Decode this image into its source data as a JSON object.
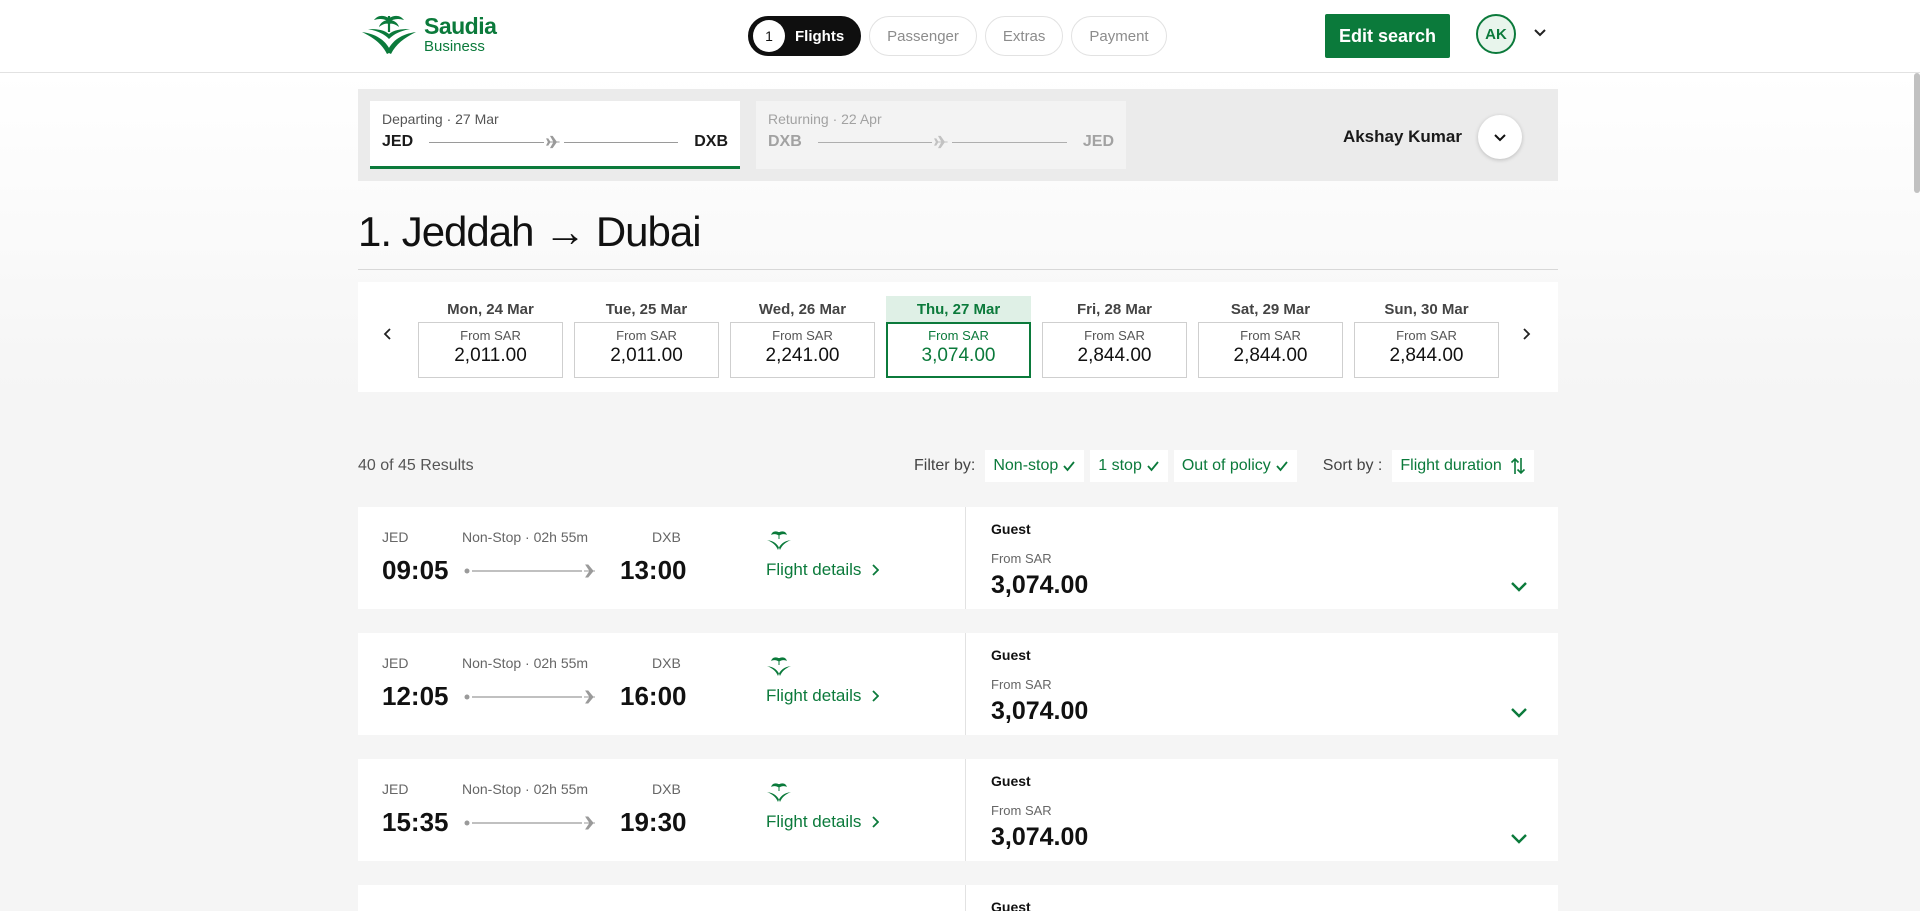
{
  "brand": {
    "line1": "Saudia",
    "line2": "Business",
    "color": "#0b7a3b"
  },
  "steps": [
    {
      "num": "1",
      "label": "Flights",
      "active": true
    },
    {
      "label": "Passenger"
    },
    {
      "label": "Extras"
    },
    {
      "label": "Payment"
    }
  ],
  "header": {
    "edit_label": "Edit search",
    "avatar_initials": "AK"
  },
  "trip": {
    "departing": {
      "label": "Departing · 27 Mar",
      "from": "JED",
      "to": "DXB"
    },
    "returning": {
      "label": "Returning · 22 Apr",
      "from": "DXB",
      "to": "JED"
    },
    "traveller_name": "Akshay Kumar"
  },
  "route_title": "1. Jeddah → Dubai",
  "dates": [
    {
      "label": "Mon, 24 Mar",
      "from": "From SAR",
      "price": "2,011.00"
    },
    {
      "label": "Tue, 25 Mar",
      "from": "From SAR",
      "price": "2,011.00"
    },
    {
      "label": "Wed, 26 Mar",
      "from": "From SAR",
      "price": "2,241.00"
    },
    {
      "label": "Thu, 27 Mar",
      "from": "From SAR",
      "price": "3,074.00",
      "selected": true
    },
    {
      "label": "Fri, 28 Mar",
      "from": "From SAR",
      "price": "2,844.00"
    },
    {
      "label": "Sat, 29 Mar",
      "from": "From SAR",
      "price": "2,844.00"
    },
    {
      "label": "Sun, 30 Mar",
      "from": "From SAR",
      "price": "2,844.00"
    }
  ],
  "results": {
    "count_label": "40 of 45 Results",
    "filter_label": "Filter by:",
    "filters": [
      "Non-stop",
      "1 stop",
      "Out of policy"
    ],
    "sort_label": "Sort by :",
    "sort_value": "Flight duration"
  },
  "flights": [
    {
      "orig": "JED",
      "dest": "DXB",
      "stops": "Non-Stop · 02h 55m",
      "dep": "09:05",
      "arr": "13:00",
      "details": "Flight details",
      "fare_type": "Guest",
      "fare_from": "From SAR",
      "fare_price": "3,074.00"
    },
    {
      "orig": "JED",
      "dest": "DXB",
      "stops": "Non-Stop · 02h 55m",
      "dep": "12:05",
      "arr": "16:00",
      "details": "Flight details",
      "fare_type": "Guest",
      "fare_from": "From SAR",
      "fare_price": "3,074.00"
    },
    {
      "orig": "JED",
      "dest": "DXB",
      "stops": "Non-Stop · 02h 55m",
      "dep": "15:35",
      "arr": "19:30",
      "details": "Flight details",
      "fare_type": "Guest",
      "fare_from": "From SAR",
      "fare_price": "3,074.00"
    },
    {
      "fare_type": "Guest"
    }
  ]
}
